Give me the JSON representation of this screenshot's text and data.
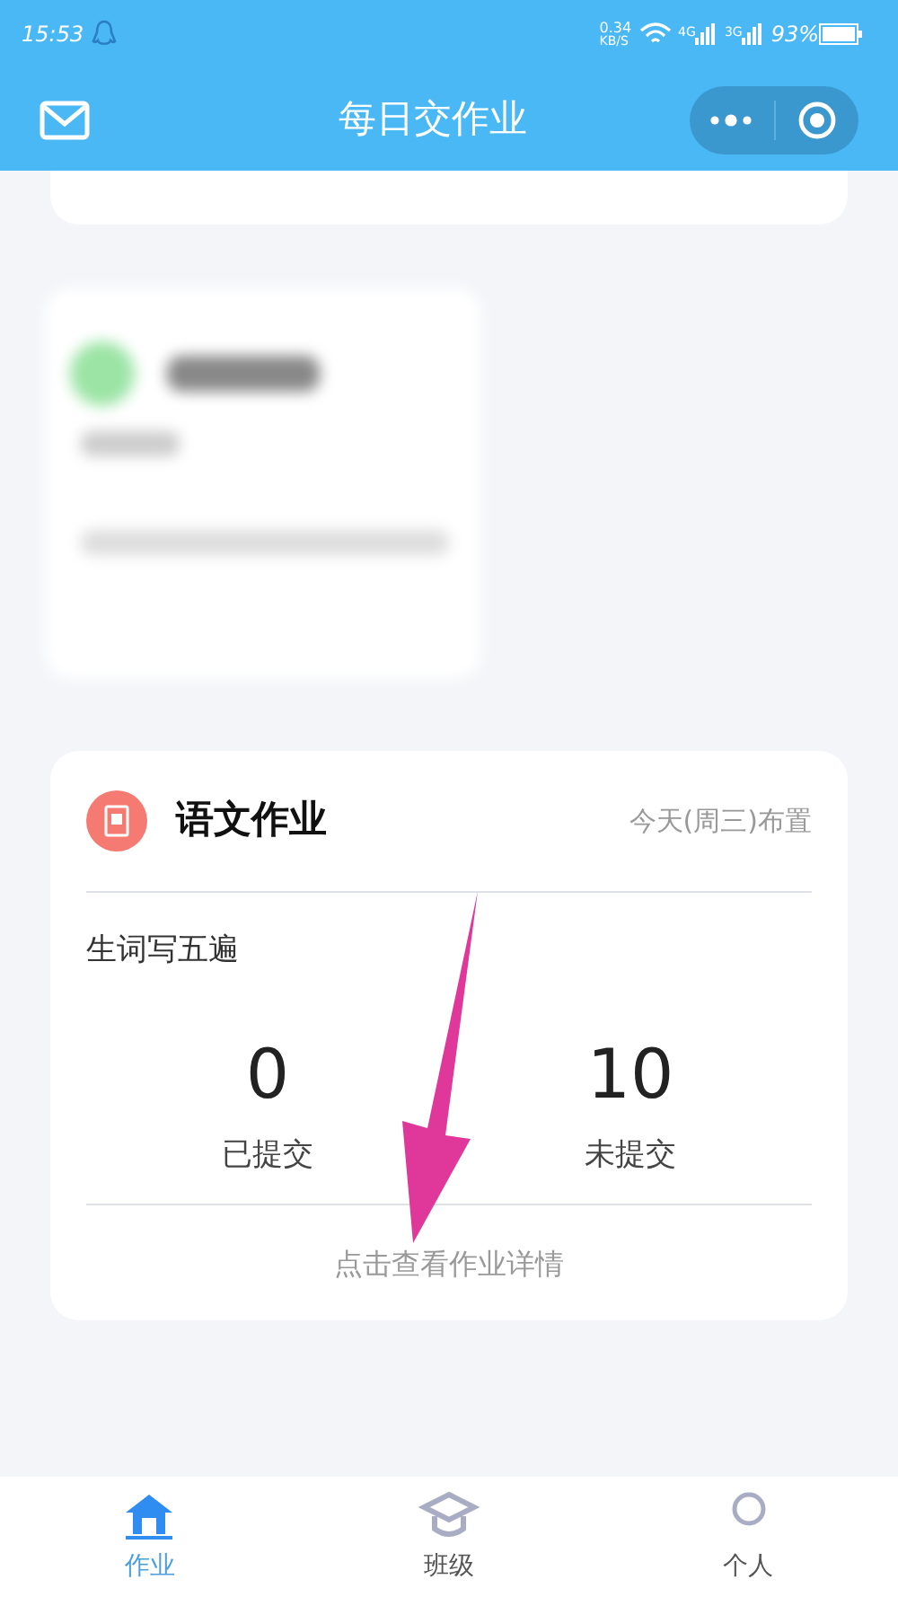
{
  "status_bar": {
    "time": "15:53",
    "speed_value": "0.34",
    "speed_unit": "KB/S",
    "network_1": "4G",
    "network_2": "3G",
    "battery": "93%"
  },
  "header": {
    "title": "每日交作业"
  },
  "homework": {
    "subject": "语文作业",
    "assigned": "今天(周三)布置",
    "task": "生词写五遍",
    "stats": [
      {
        "value": "0",
        "label": "已提交"
      },
      {
        "value": "10",
        "label": "未提交"
      }
    ],
    "details_link": "点击查看作业详情"
  },
  "tabs": [
    {
      "label": "作业",
      "kind": "home",
      "selected": true
    },
    {
      "label": "班级",
      "kind": "class",
      "selected": false
    },
    {
      "label": "个人",
      "kind": "person",
      "selected": false
    }
  ]
}
